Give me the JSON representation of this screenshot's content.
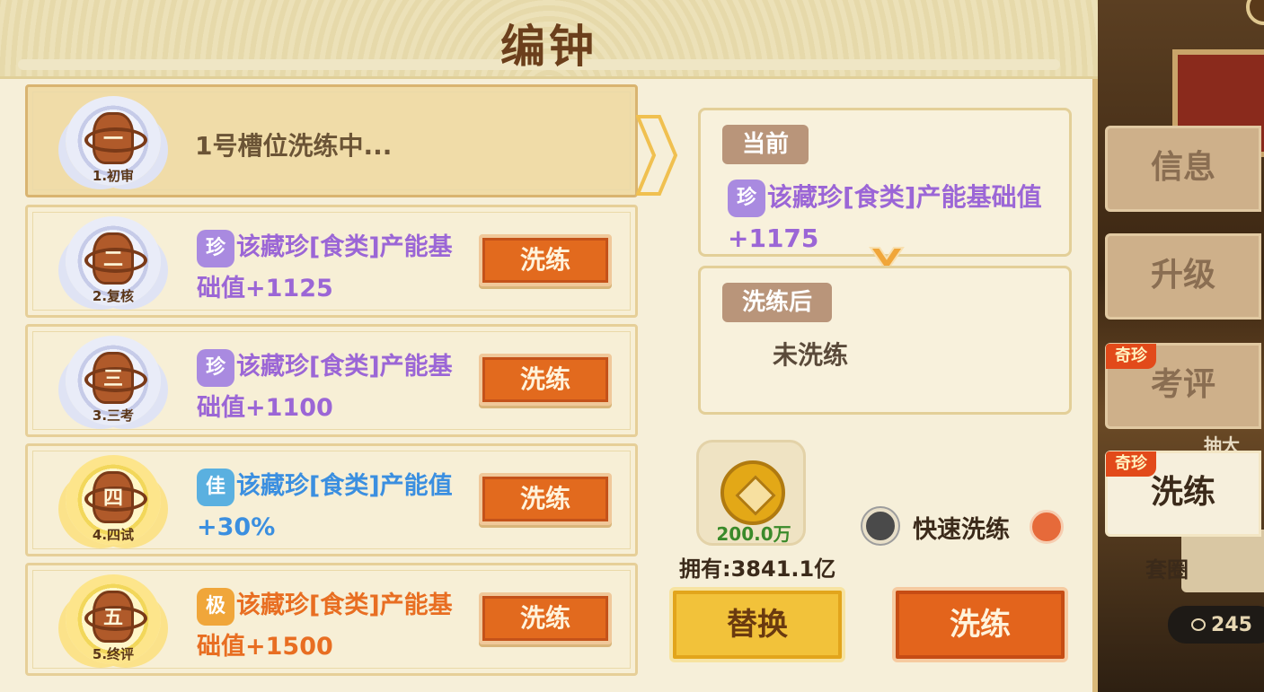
{
  "title": "编钟",
  "slots": [
    {
      "num": "一",
      "rank": "1.初审",
      "status": "1号槽位洗练中...",
      "active": true
    },
    {
      "num": "二",
      "rank": "2.复核",
      "tag": "珍",
      "desc": "该藏珍[食类]产能基础值+1125",
      "button": "洗练"
    },
    {
      "num": "三",
      "rank": "3.三考",
      "tag": "珍",
      "desc": "该藏珍[食类]产能基础值+1100",
      "button": "洗练"
    },
    {
      "num": "四",
      "rank": "4.四试",
      "tag": "佳",
      "desc": "该藏珍[食类]产能值+30%",
      "button": "洗练"
    },
    {
      "num": "五",
      "rank": "5.终评",
      "tag": "极",
      "desc": "该藏珍[食类]产能基础值+1500",
      "button": "洗练"
    }
  ],
  "current": {
    "label": "当前",
    "tag": "珍",
    "text": "该藏珍[食类]产能基础值+1175"
  },
  "after": {
    "label": "洗练后",
    "text": "未洗练"
  },
  "cost": {
    "amount": "200.0万",
    "owned": "拥有:3841.1亿"
  },
  "quick": {
    "label": "快速洗练"
  },
  "buttons": {
    "replace": "替换",
    "wash": "洗练"
  },
  "tabs": [
    {
      "label": "信息"
    },
    {
      "label": "升级"
    },
    {
      "label": "考评",
      "corner": "奇珍"
    },
    {
      "label": "洗练",
      "corner": "奇珍",
      "active": true
    }
  ],
  "scene": {
    "coins": "245",
    "pick": "抽大",
    "ring": "套圈"
  },
  "colors": {
    "purple": "#9b66d6",
    "blue": "#3b8fe0",
    "orange": "#e86e22",
    "accent": "#e26a1e"
  }
}
